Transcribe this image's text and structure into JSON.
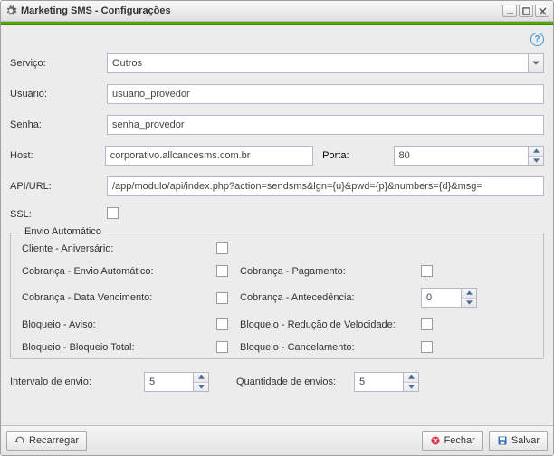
{
  "window": {
    "title": "Marketing SMS - Configurações"
  },
  "form": {
    "servico": {
      "label": "Serviço:",
      "value": "Outros"
    },
    "usuario": {
      "label": "Usuário:",
      "value": "usuario_provedor"
    },
    "senha": {
      "label": "Senha:",
      "value": "senha_provedor"
    },
    "host": {
      "label": "Host:",
      "value": "corporativo.allcancesms.com.br"
    },
    "porta": {
      "label": "Porta:",
      "value": "80"
    },
    "apiurl": {
      "label": "API/URL:",
      "value": "/app/modulo/api/index.php?action=sendsms&lgn={u}&pwd={p}&numbers={d}&msg="
    },
    "ssl": {
      "label": "SSL:"
    }
  },
  "auto": {
    "legend": "Envio Automático",
    "cliente_aniversario": {
      "label": "Cliente - Aniversário:"
    },
    "cobranca_envio_auto": {
      "label": "Cobrança - Envio Automático:"
    },
    "cobranca_pagamento": {
      "label": "Cobrança - Pagamento:"
    },
    "cobranca_data_venc": {
      "label": "Cobrança - Data Vencimento:"
    },
    "cobranca_antecedencia": {
      "label": "Cobrança - Antecedência:",
      "value": "0"
    },
    "bloqueio_aviso": {
      "label": "Bloqueio - Aviso:"
    },
    "bloqueio_reducao": {
      "label": "Bloqueio - Redução de Velocidade:"
    },
    "bloqueio_total": {
      "label": "Bloqueio - Bloqueio Total:"
    },
    "bloqueio_cancelamento": {
      "label": "Bloqueio - Cancelamento:"
    }
  },
  "bottom": {
    "intervalo": {
      "label": "Intervalo de envio:",
      "value": "5"
    },
    "quantidade": {
      "label": "Quantidade de envios:",
      "value": "5"
    }
  },
  "toolbar": {
    "recarregar": "Recarregar",
    "fechar": "Fechar",
    "salvar": "Salvar"
  }
}
